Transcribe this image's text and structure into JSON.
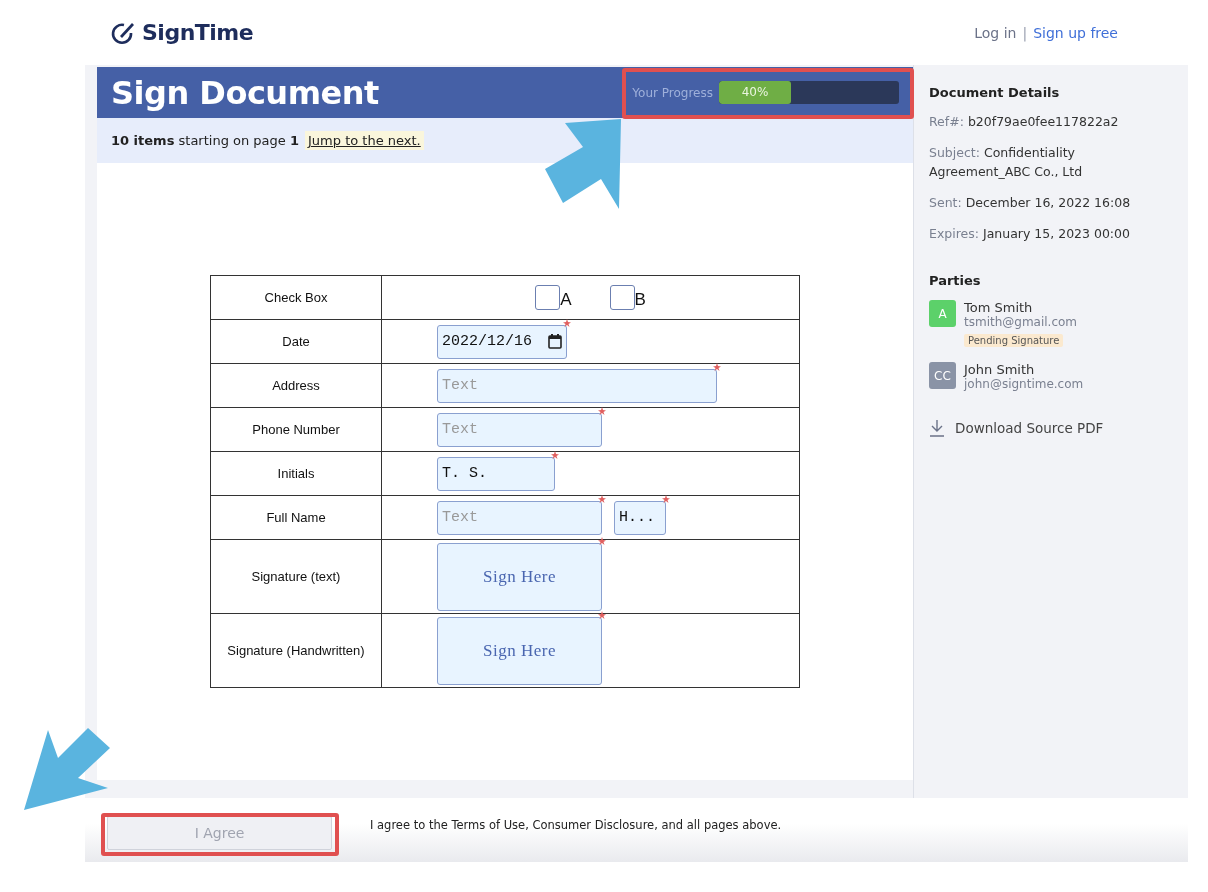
{
  "header": {
    "logo": "SignTime",
    "login": "Log in",
    "separator": "|",
    "signup": "Sign up free"
  },
  "title": "Sign Document",
  "progress": {
    "label": "Your Progress",
    "level": 0.4,
    "reading": "40%"
  },
  "notice": {
    "text": "**10 items** starting on page **1**",
    "link": "Jump to the next."
  },
  "form": {
    "rows": [
      {
        "label": "Check Box",
        "kind": "checkbox",
        "options": [
          {
            "label": "A",
            "checked": false
          },
          {
            "label": "B",
            "checked": false
          }
        ]
      },
      {
        "label": "Date",
        "kind": "date",
        "fields": [
          {
            "value": "2022/12/16",
            "required": true
          }
        ]
      },
      {
        "label": "Address",
        "kind": "text",
        "fields": [
          {
            "placeholder": "Text",
            "required": true
          }
        ]
      },
      {
        "label": "Phone Number",
        "kind": "text",
        "fields": [
          {
            "placeholder": "Text",
            "required": true
          }
        ]
      },
      {
        "label": "Initials",
        "kind": "text",
        "fields": [
          {
            "value": "T. S.",
            "required": true
          }
        ]
      },
      {
        "label": "Full Name",
        "kind": "text",
        "fields": [
          {
            "placeholder": "Text",
            "required": true
          },
          {
            "value": "H...",
            "required": true
          }
        ]
      },
      {
        "label": "Signature (text)",
        "kind": "signature",
        "fields": [
          {
            "text": "Sign Here",
            "required": true
          }
        ]
      },
      {
        "label": "Signature (Handwritten)",
        "kind": "signature",
        "fields": [
          {
            "text": "Sign Here",
            "required": true
          }
        ]
      }
    ]
  },
  "details": {
    "heading": "Document Details",
    "items": [
      {
        "label": "Ref#:",
        "value": "b20f79ae0fee117822a2"
      },
      {
        "label": "Subject:",
        "value": "Confidentiality Agreement_ABC Co., Ltd"
      },
      {
        "label": "Sent:",
        "value": "December 16, 2022 16:08"
      },
      {
        "label": "Expires:",
        "value": "January 15, 2023 00:00"
      }
    ]
  },
  "parties": {
    "heading": "Parties",
    "items": [
      {
        "initials": "A",
        "name": "Tom Smith",
        "email": "tsmith@gmail.com",
        "status": "Pending Signature",
        "color": "#5cd16a"
      },
      {
        "initials": "CC",
        "name": "John Smith",
        "email": "john@signtime.com",
        "color": "#8a93a6"
      }
    ]
  },
  "download": "Download Source PDF",
  "footer": {
    "button": "I Agree",
    "disabled": true,
    "terms": "I agree to the Terms of Use, Consumer Disclosure, and all pages above."
  }
}
